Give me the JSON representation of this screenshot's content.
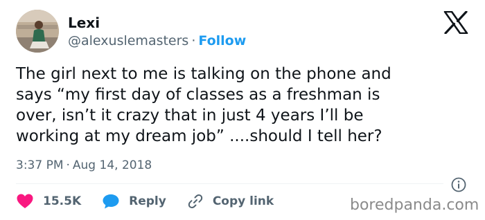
{
  "author": {
    "name": "Lexi",
    "handle": "@alexuslemasters",
    "separator": "·",
    "follow_label": "Follow"
  },
  "tweet": {
    "text": "The girl next to me is talking on the phone and\nsays “my first day of classes as a freshman is\nover, isn’t it crazy that in just 4 years I’ll be\nworking at my dream job” ....should I tell her?",
    "time": "3:37 PM",
    "separator": "·",
    "date": "Aug 14, 2018"
  },
  "actions": {
    "like_count": "15.5K",
    "reply_label": "Reply",
    "copy_link_label": "Copy link"
  },
  "watermark": "boredpanda.com",
  "icons": {
    "logo": "x-logo-icon",
    "info": "info-icon",
    "like": "heart-icon",
    "reply": "speech-bubble-icon",
    "copy": "link-icon"
  },
  "colors": {
    "text": "#0f1419",
    "secondary": "#536471",
    "accent": "#1d9bf0",
    "like": "#f91880",
    "watermark": "#8a8a8a"
  }
}
